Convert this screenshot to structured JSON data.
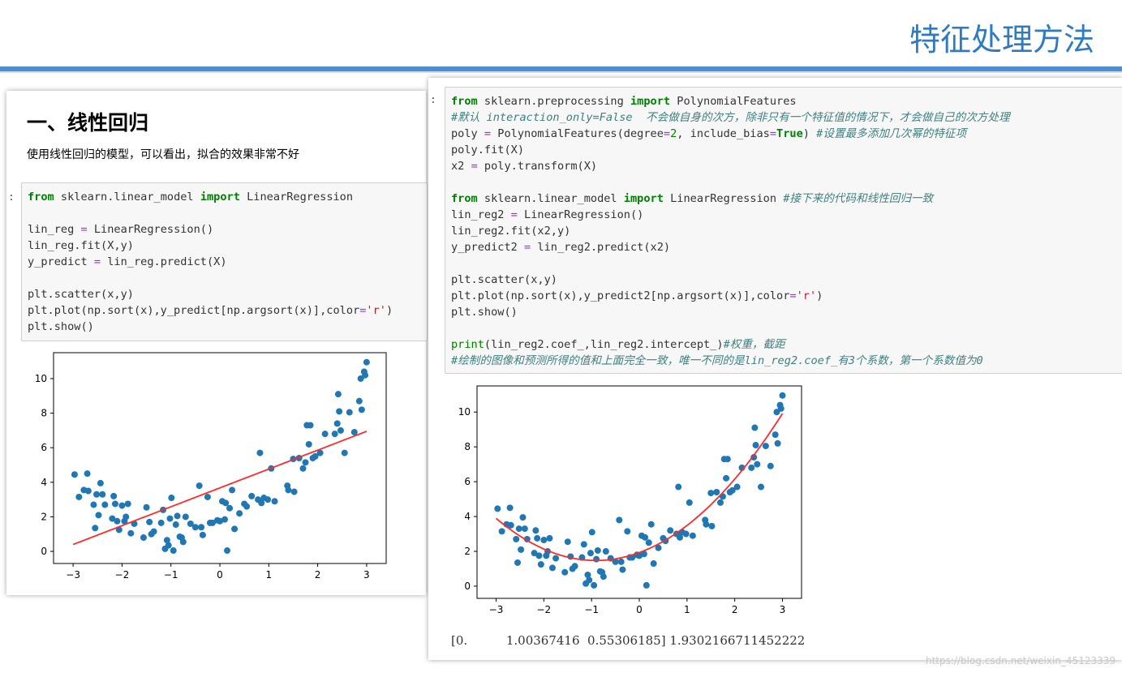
{
  "slide_title": "特征处理方法",
  "section": {
    "heading": "一、线性回归",
    "description": "使用线性回归的模型，可以看出，拟合的效果非常不好"
  },
  "cells": {
    "prompt_marker": ":",
    "left_code_lines": [
      "from sklearn.linear_model import LinearRegression",
      "",
      "lin_reg = LinearRegression()",
      "lin_reg.fit(X,y)",
      "y_predict = lin_reg.predict(X)",
      "",
      "plt.scatter(x,y)",
      "plt.plot(np.sort(x),y_predict[np.argsort(x)],color='r')",
      "plt.show()"
    ],
    "right_code_lines": [
      "from sklearn.preprocessing import PolynomialFeatures",
      "#默认 interaction_only=False  不会做自身的次方，除非只有一个特征值的情况下，才会做自己的次方处理",
      "poly = PolynomialFeatures(degree=2, include_bias=True) #设置最多添加几次幂的特征项",
      "poly.fit(X)",
      "x2 = poly.transform(X)",
      "",
      "from sklearn.linear_model import LinearRegression #接下来的代码和线性回归一致",
      "lin_reg2 = LinearRegression()",
      "lin_reg2.fit(x2,y)",
      "y_predict2 = lin_reg2.predict(x2)",
      "",
      "plt.scatter(x,y)",
      "plt.plot(np.sort(x),y_predict2[np.argsort(x)],color='r')",
      "plt.show()",
      "",
      "print(lin_reg2.coef_,lin_reg2.intercept_)#权重，截距",
      "#绘制的图像和预测所得的值和上面完全一致，唯一不同的是lin_reg2.coef_有3个系数，第一个系数值为0"
    ],
    "output_text": "[0.          1.00367416  0.55306185] 1.9302166711452222"
  },
  "watermark": "https://blog.csdn.net/weixin_45123339",
  "chart_data": [
    {
      "type": "scatter",
      "title": "",
      "xlabel": "",
      "ylabel": "",
      "xlim": [
        -3.4,
        3.4
      ],
      "ylim": [
        -0.7,
        11.5
      ],
      "xticks": [
        -3,
        -2,
        -1,
        0,
        1,
        2,
        3
      ],
      "yticks": [
        0,
        2,
        4,
        6,
        8,
        10
      ],
      "grid": false,
      "point_color": "#1f77b4",
      "line_color": "#ff2a2a",
      "points": [
        [
          -2.97,
          4.45
        ],
        [
          -2.88,
          3.15
        ],
        [
          -2.78,
          3.55
        ],
        [
          -2.71,
          4.5
        ],
        [
          -2.69,
          3.5
        ],
        [
          -2.58,
          2.7
        ],
        [
          -2.55,
          1.35
        ],
        [
          -2.52,
          3.3
        ],
        [
          -2.48,
          2.1
        ],
        [
          -2.44,
          3.95
        ],
        [
          -2.4,
          3.3
        ],
        [
          -2.35,
          2.7
        ],
        [
          -2.2,
          1.9
        ],
        [
          -2.17,
          3.2
        ],
        [
          -2.14,
          2.75
        ],
        [
          -2.1,
          1.75
        ],
        [
          -2.06,
          1.25
        ],
        [
          -2.0,
          2.65
        ],
        [
          -1.95,
          1.75
        ],
        [
          -1.92,
          2.0
        ],
        [
          -1.88,
          2.75
        ],
        [
          -1.82,
          1.05
        ],
        [
          -1.75,
          1.6
        ],
        [
          -1.56,
          0.8
        ],
        [
          -1.5,
          2.55
        ],
        [
          -1.44,
          1.7
        ],
        [
          -1.4,
          1.0
        ],
        [
          -1.35,
          1.15
        ],
        [
          -1.2,
          1.65
        ],
        [
          -1.16,
          2.4
        ],
        [
          -1.12,
          0.15
        ],
        [
          -1.08,
          0.65
        ],
        [
          -1.05,
          0.35
        ],
        [
          -1.02,
          1.9
        ],
        [
          -0.99,
          3.1
        ],
        [
          -0.95,
          0.05
        ],
        [
          -0.9,
          1.55
        ],
        [
          -0.87,
          2.05
        ],
        [
          -0.82,
          0.85
        ],
        [
          -0.78,
          0.8
        ],
        [
          -0.75,
          0.55
        ],
        [
          -0.7,
          2.0
        ],
        [
          -0.6,
          1.6
        ],
        [
          -0.5,
          1.4
        ],
        [
          -0.42,
          3.8
        ],
        [
          -0.38,
          1.4
        ],
        [
          -0.35,
          0.95
        ],
        [
          -0.25,
          3.15
        ],
        [
          -0.2,
          1.65
        ],
        [
          -0.15,
          1.65
        ],
        [
          -0.05,
          1.8
        ],
        [
          0.0,
          1.75
        ],
        [
          0.05,
          2.9
        ],
        [
          0.1,
          1.85
        ],
        [
          0.12,
          2.8
        ],
        [
          0.15,
          0.05
        ],
        [
          0.2,
          2.5
        ],
        [
          0.25,
          3.55
        ],
        [
          0.3,
          1.3
        ],
        [
          0.4,
          2.2
        ],
        [
          0.5,
          2.75
        ],
        [
          0.55,
          2.6
        ],
        [
          0.65,
          3.2
        ],
        [
          0.78,
          3.0
        ],
        [
          0.82,
          5.7
        ],
        [
          0.85,
          2.8
        ],
        [
          0.9,
          3.1
        ],
        [
          0.98,
          3.0
        ],
        [
          1.05,
          4.8
        ],
        [
          1.12,
          2.9
        ],
        [
          1.38,
          3.8
        ],
        [
          1.4,
          3.55
        ],
        [
          1.5,
          5.35
        ],
        [
          1.52,
          3.45
        ],
        [
          1.62,
          5.4
        ],
        [
          1.7,
          4.8
        ],
        [
          1.75,
          5.15
        ],
        [
          1.78,
          7.3
        ],
        [
          1.82,
          6.2
        ],
        [
          1.85,
          7.3
        ],
        [
          1.9,
          5.4
        ],
        [
          1.95,
          5.5
        ],
        [
          2.05,
          5.7
        ],
        [
          2.15,
          6.8
        ],
        [
          2.35,
          6.8
        ],
        [
          2.4,
          7.4
        ],
        [
          2.42,
          9.1
        ],
        [
          2.44,
          8.1
        ],
        [
          2.47,
          7.0
        ],
        [
          2.55,
          5.7
        ],
        [
          2.65,
          8.05
        ],
        [
          2.75,
          6.9
        ],
        [
          2.85,
          8.7
        ],
        [
          2.88,
          10.0
        ],
        [
          2.9,
          8.2
        ],
        [
          2.95,
          10.4
        ],
        [
          2.97,
          10.2
        ],
        [
          3.0,
          10.95
        ]
      ],
      "fit_line": [
        [
          -3.0,
          0.4
        ],
        [
          3.0,
          6.95
        ]
      ]
    },
    {
      "type": "scatter",
      "title": "",
      "xlabel": "",
      "ylabel": "",
      "xlim": [
        -3.4,
        3.4
      ],
      "ylim": [
        -0.7,
        11.5
      ],
      "xticks": [
        -3,
        -2,
        -1,
        0,
        1,
        2,
        3
      ],
      "yticks": [
        0,
        2,
        4,
        6,
        8,
        10
      ],
      "grid": false,
      "point_color": "#1f77b4",
      "line_color": "#ff2a2a",
      "points": "same as first chart",
      "fit_curve": {
        "coef": [
          0.0,
          1.00367416,
          0.55306185
        ],
        "intercept": 1.9302166711452222
      }
    }
  ]
}
